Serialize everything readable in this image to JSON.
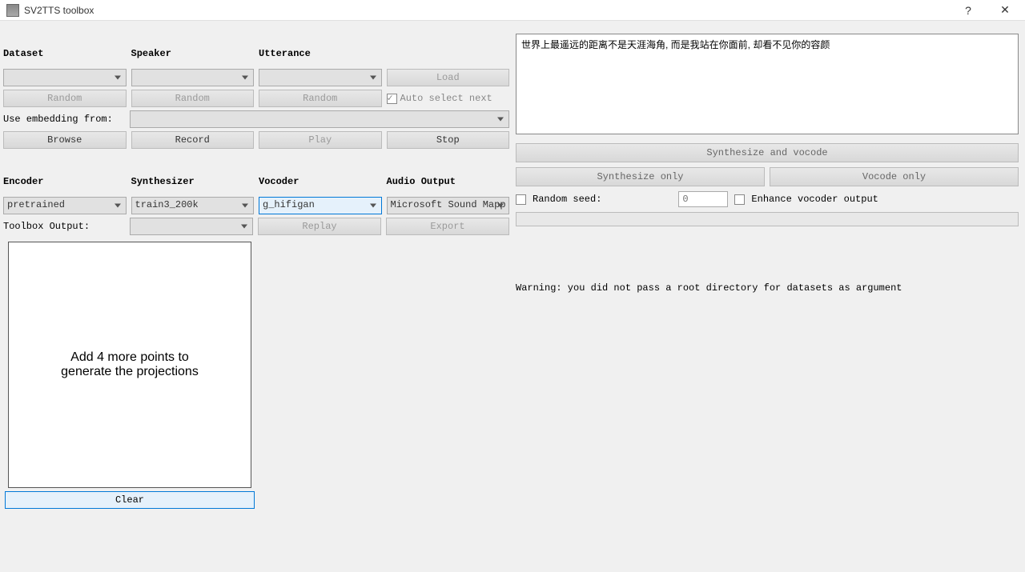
{
  "window": {
    "title": "SV2TTS toolbox"
  },
  "labels": {
    "dataset": "Dataset",
    "speaker": "Speaker",
    "utterance": "Utterance",
    "load": "Load",
    "random": "Random",
    "auto_select": "Auto select next",
    "use_embedding": "Use embedding from:",
    "browse": "Browse",
    "record": "Record",
    "play": "Play",
    "stop": "Stop",
    "encoder": "Encoder",
    "synthesizer": "Synthesizer",
    "vocoder": "Vocoder",
    "audio_output": "Audio Output",
    "toolbox_output": "Toolbox Output:",
    "replay": "Replay",
    "export": "Export",
    "projection_hint": "Add 4 more points to\ngenerate the projections",
    "clear": "Clear"
  },
  "selects": {
    "encoder": "pretrained",
    "synthesizer": "train3_200k",
    "vocoder": "g_hifigan",
    "audio_output": "Microsoft Sound Mapp"
  },
  "right": {
    "text_input": "世界上最遥远的距离不是天涯海角, 而是我站在你面前, 却看不见你的容颜",
    "synth_vocode": "Synthesize and vocode",
    "synth_only": "Synthesize only",
    "vocode_only": "Vocode only",
    "random_seed": "Random seed:",
    "seed_value": "0",
    "enhance": "Enhance vocoder output",
    "warning": "Warning: you did not pass a root directory for datasets as argument"
  }
}
